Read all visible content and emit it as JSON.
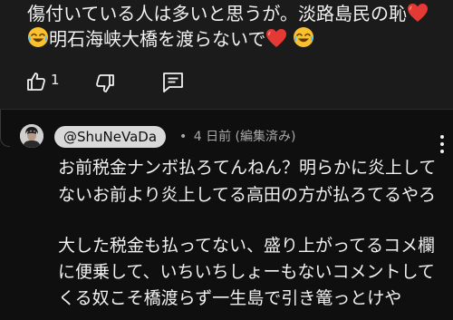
{
  "parent_comment": {
    "text_line1": "傷付いている人は多いと思うが。淡路島民の恥",
    "text_line2": "明石海峡大橋を渡らないで",
    "like_count": "1",
    "emoji_heart": "red-heart",
    "emoji_laugh": "face-with-tears-of-joy"
  },
  "reply": {
    "handle": "@ShuNeVaDa",
    "separator": "•",
    "timestamp": "4 日前",
    "edited_label": "(編集済み)",
    "lines": [
      "お前税金ナンボ払ろてんねん？明らかに炎上して",
      "ないお前より炎上してる高田の方が払ろてるやろ",
      "大した税金も払ってない、盛り上がってるコメ欄",
      "に便乗して、いちいちしょーもないコメントして",
      "くる奴こそ橋渡らず一生島で引き篭っとけや"
    ]
  },
  "colors": {
    "background": "#0f0f0f",
    "parent_background": "#1b1b1b",
    "text": "#f1f1f1",
    "meta_text": "#aaaaaa",
    "handle_pill": "#d9d9d9",
    "heart": "#e53935",
    "emoji_face": "#fbc02d"
  },
  "icons": {
    "like": "thumbs-up-icon",
    "dislike": "thumbs-down-icon",
    "reply": "comment-reply-icon",
    "more": "more-vert-icon"
  }
}
